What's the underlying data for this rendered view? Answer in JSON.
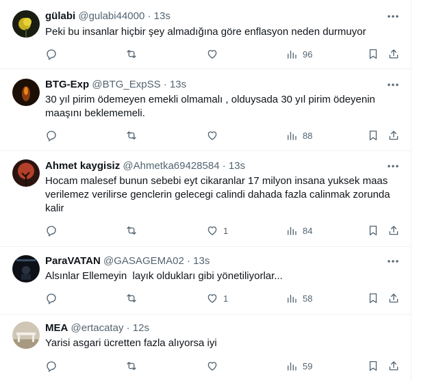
{
  "tweets": [
    {
      "name": "gülabi",
      "handle": "@gulabi44000",
      "time": "13s",
      "text": "Peki bu insanlar hiçbir şey almadığına göre enflasyon neden durmuyor",
      "reply_count": "",
      "like_count": "",
      "view_count": "96"
    },
    {
      "name": "BTG-Exp",
      "handle": "@BTG_ExpSS",
      "time": "13s",
      "text": "30 yıl pirim ödemeyen emekli olmamalı , olduysada 30 yıl pirim ödeyenin maaşını beklememeli.",
      "reply_count": "",
      "like_count": "",
      "view_count": "88"
    },
    {
      "name": "Ahmet kaygisiz",
      "handle": "@Ahmetka69428584",
      "time": "13s",
      "text": "Hocam malesef bunun sebebi eyt cikaranlar 17 milyon insana yuksek maas verilemez verilirse genclerin gelecegi calindi dahada fazla calinmak zorunda kalir",
      "reply_count": "",
      "like_count": "1",
      "view_count": "84"
    },
    {
      "name": "ParaVATAN",
      "handle": "@GASAGEMA02",
      "time": "13s",
      "text": "Alsınlar Ellemeyin  layık oldukları gibi yönetiliyorlar...",
      "reply_count": "",
      "like_count": "1",
      "view_count": "58"
    },
    {
      "name": "MEA",
      "handle": "@ertacatay",
      "time": "12s",
      "text": "Yarisi asgari ücretten fazla alıyorsa iyi",
      "reply_count": "",
      "like_count": "",
      "view_count": "59"
    }
  ],
  "separator": "·",
  "icons": {
    "more": "more-horizontal-icon",
    "reply": "reply-icon",
    "retweet": "retweet-icon",
    "like": "like-icon",
    "views": "views-icon",
    "bookmark": "bookmark-icon",
    "share": "share-icon"
  },
  "colors": {
    "text": "#0f1419",
    "secondary": "#536471",
    "border": "#eff3f4",
    "background": "#ffffff"
  }
}
